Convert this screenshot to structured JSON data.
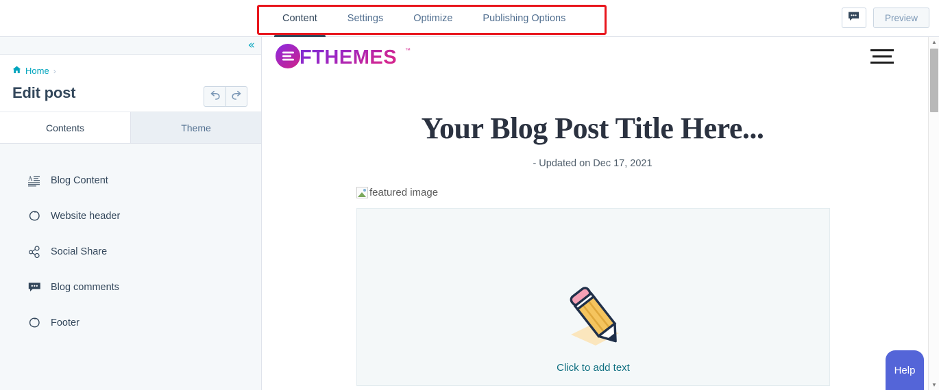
{
  "topbar": {
    "tabs": [
      {
        "label": "Content",
        "active": true
      },
      {
        "label": "Settings",
        "active": false
      },
      {
        "label": "Optimize",
        "active": false
      },
      {
        "label": "Publishing Options",
        "active": false
      }
    ],
    "comment_icon": "comment-icon",
    "preview_label": "Preview"
  },
  "annotation": {
    "color": "#e8161d",
    "target": "editor-tab-bar"
  },
  "sidebar": {
    "collapse_icon": "double-chevron-left-icon",
    "breadcrumb": {
      "home_icon": "home-icon",
      "home_label": "Home",
      "separator": "›"
    },
    "title": "Edit post",
    "undo_icon": "undo-icon",
    "redo_icon": "redo-icon",
    "subtabs": [
      {
        "label": "Contents",
        "active": true
      },
      {
        "label": "Theme",
        "active": false
      }
    ],
    "items": [
      {
        "label": "Blog Content",
        "icon": "text-lines-icon"
      },
      {
        "label": "Website header",
        "icon": "module-icon"
      },
      {
        "label": "Social Share",
        "icon": "social-share-icon"
      },
      {
        "label": "Blog comments",
        "icon": "comment-bubble-icon"
      },
      {
        "label": "Footer",
        "icon": "module-icon"
      }
    ]
  },
  "canvas": {
    "logo": {
      "name": "ofthemes-logo",
      "text": "OFTHEMES",
      "trademark": "™",
      "gradient_from": "#6d3fd4",
      "gradient_to": "#d3258f"
    },
    "menu_icon": "hamburger-menu-icon",
    "post_title": "Your Blog Post Title Here...",
    "post_meta": "- Updated on Dec 17, 2021",
    "featured_image_alt": "featured image",
    "dropzone": {
      "illustration": "pencil-icon",
      "label": "Click to add text"
    }
  },
  "scrollbar": {
    "up_arrow": "▲",
    "down_arrow": "▼"
  },
  "help": {
    "label": "Help"
  }
}
